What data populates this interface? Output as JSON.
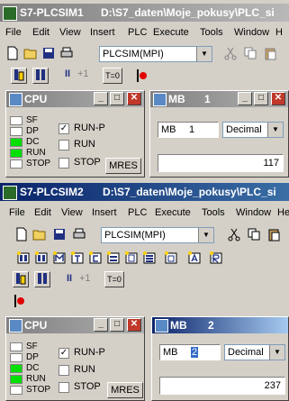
{
  "win1": {
    "title": "S7-PLCSIM1",
    "path": "D:\\S7_daten\\Moje_pokusy\\PLC_si",
    "menu": [
      "File",
      "Edit",
      "View",
      "Insert",
      "PLC",
      "Execute",
      "Tools",
      "Window",
      "H"
    ],
    "combo": "PLCSIM(MPI)",
    "plus1": "+1",
    "t0": "T=0",
    "cpu": {
      "title": "CPU",
      "leds": [
        "SF",
        "DP",
        "DC",
        "RUN",
        "STOP"
      ],
      "runp": "RUN-P",
      "run": "RUN",
      "stop": "STOP",
      "mres": "MRES"
    },
    "mb": {
      "title": "MB",
      "num": "1",
      "label": "MB",
      "addr": "1",
      "format": "Decimal",
      "value": "117"
    }
  },
  "win2": {
    "title": "S7-PLCSIM2",
    "path": "D:\\S7_daten\\Moje_pokusy\\PLC_si",
    "menu": [
      "File",
      "Edit",
      "View",
      "Insert",
      "PLC",
      "Execute",
      "Tools",
      "Window",
      "He"
    ],
    "combo": "PLCSIM(MPI)",
    "plus1": "+1",
    "t0": "T=0",
    "cpu": {
      "title": "CPU",
      "leds": [
        "SF",
        "DP",
        "DC",
        "RUN",
        "STOP"
      ],
      "runp": "RUN-P",
      "run": "RUN",
      "stop": "STOP",
      "mres": "MRES"
    },
    "mb": {
      "title": "MB",
      "num": "2",
      "label": "MB",
      "addr": "2",
      "format": "Decimal",
      "value": "237"
    }
  }
}
